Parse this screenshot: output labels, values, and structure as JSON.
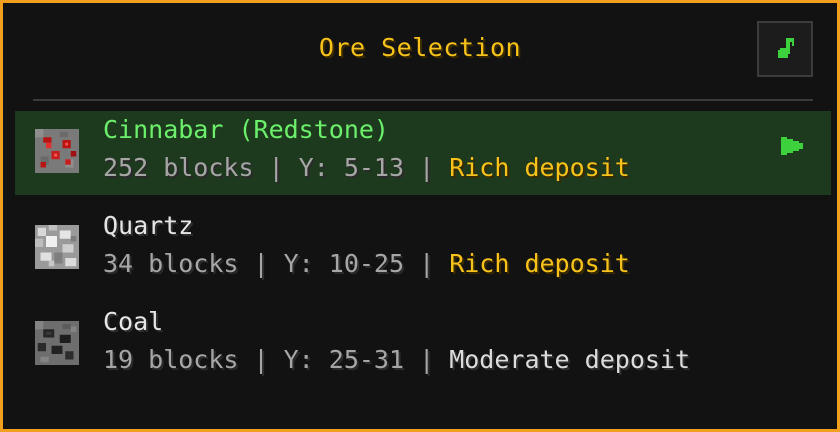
{
  "panel": {
    "title": "Ore Selection",
    "accent_color": "#f0a01c",
    "music_button_icon": "music-note-icon"
  },
  "ores": [
    {
      "name": "Cinnabar (Redstone)",
      "blocks": "252 blocks",
      "y_range": "Y: 5-13",
      "deposit": "Rich deposit",
      "selected": true,
      "icon": "redstone-ore-icon"
    },
    {
      "name": "Quartz",
      "blocks": "34 blocks",
      "y_range": "Y: 10-25",
      "deposit": "Rich deposit",
      "selected": false,
      "icon": "quartz-ore-icon"
    },
    {
      "name": "Coal",
      "blocks": "19 blocks",
      "y_range": "Y: 25-31",
      "deposit": "Moderate deposit",
      "selected": false,
      "icon": "coal-ore-icon"
    }
  ]
}
